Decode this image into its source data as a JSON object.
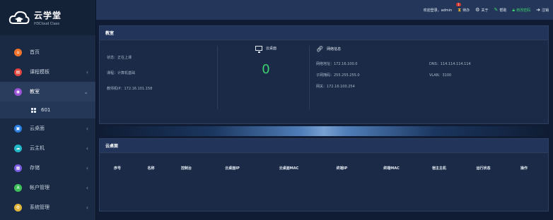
{
  "brand": {
    "title": "云学堂",
    "subtitle": "H3Cloud Class"
  },
  "topbar": {
    "welcome": "欢迎登录，admin",
    "badge_count": "1",
    "todo": "待办",
    "about": "关于",
    "help": "帮助",
    "change_password": "修改密码",
    "logout": "注销"
  },
  "sidebar": {
    "items": [
      {
        "label": "首页",
        "icon": "home-icon",
        "color": "#f0742c"
      },
      {
        "label": "课程模板",
        "icon": "template-icon",
        "color": "#e0453c"
      },
      {
        "label": "教室",
        "icon": "classroom-icon",
        "color": "#9b54d6"
      },
      {
        "label": "云桌面",
        "icon": "desktop-icon",
        "color": "#2a7fe0"
      },
      {
        "label": "云主机",
        "icon": "host-icon",
        "color": "#22b8c8"
      },
      {
        "label": "存储",
        "icon": "storage-icon",
        "color": "#7b5ce0"
      },
      {
        "label": "帐户管理",
        "icon": "account-icon",
        "color": "#3fbf5a"
      },
      {
        "label": "系统管理",
        "icon": "settings-icon",
        "color": "#e0b33a"
      }
    ],
    "sub_items": [
      {
        "label": "601"
      }
    ]
  },
  "panel1": {
    "title": "教室",
    "status": "状态：正在上课",
    "course": "课程：计算机基础",
    "teacher_ip": "教师机IP：172.16.101.158",
    "desktop_label": "云桌面",
    "desktop_count": "0",
    "network_label": "网络信息",
    "network": {
      "ip": "网络地址：172.16.100.0",
      "mask": "子网掩码：255.255.255.0",
      "gateway": "网关：172.16.100.254",
      "dns": "DNS：114.114.114.114",
      "vlan": "VLAN：3100"
    }
  },
  "panel2": {
    "title": "云桌面",
    "columns": [
      "序号",
      "名称",
      "控制台",
      "云桌面IP",
      "云桌面MAC",
      "终端IP",
      "终端MAC",
      "宿主主机",
      "运行状态",
      "操作"
    ]
  },
  "colors": {
    "accent_green": "#3bd16f",
    "sidebar_bg": "#1a2a44",
    "topbar_bg": "#24375a"
  }
}
